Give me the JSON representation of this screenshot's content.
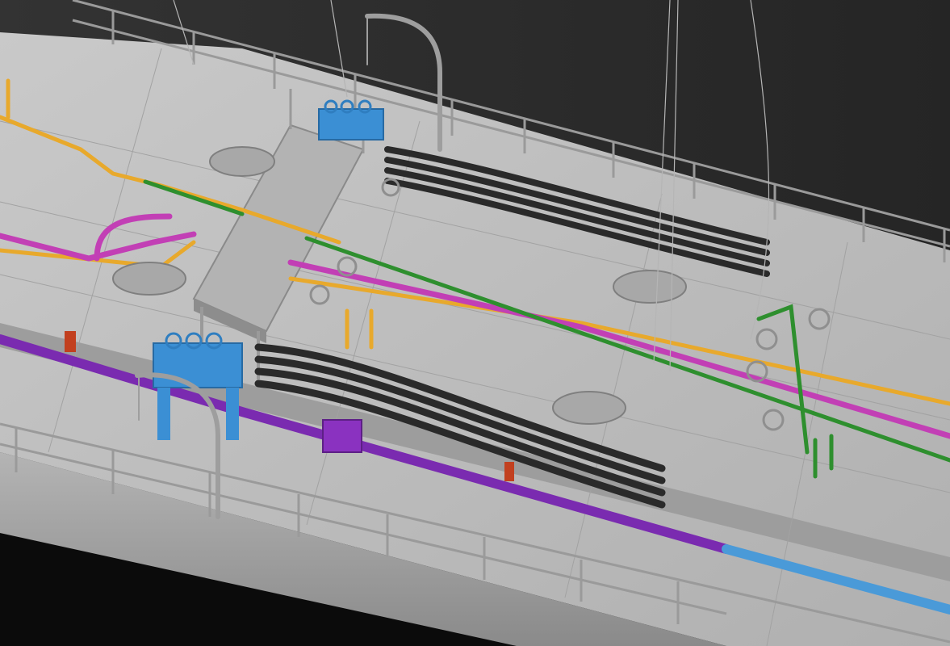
{
  "scene": {
    "subject": "tanker-deck-render",
    "colors": {
      "background": "#2a2a2a",
      "deck": "#bdbdbd",
      "deck_shadow": "#8f8f8f",
      "hull_side": "#a6a6a6",
      "water": "#0b0b0b",
      "railing": "#9a9a9a",
      "catwalk": "#b3b3b3",
      "pipe_yellow": "#e8a92c",
      "pipe_magenta": "#c23fb5",
      "pipe_green": "#2e8f2e",
      "pipe_purple": "#7a2bb0",
      "pipe_blue": "#4a9ad8",
      "valve_blue": "#3b8fd4",
      "hose_black": "#2a2a2a",
      "fitting_red": "#c2401f",
      "hatch": "#a8a8a8"
    },
    "objects": [
      {
        "name": "deck",
        "kind": "surface"
      },
      {
        "name": "hull-side",
        "kind": "surface"
      },
      {
        "name": "water",
        "kind": "surface"
      },
      {
        "name": "far-railing",
        "kind": "railing"
      },
      {
        "name": "near-railing",
        "kind": "railing"
      },
      {
        "name": "catwalk",
        "kind": "walkway"
      },
      {
        "name": "yellow-pipeline",
        "kind": "pipe"
      },
      {
        "name": "magenta-pipeline",
        "kind": "pipe"
      },
      {
        "name": "green-pipeline",
        "kind": "pipe"
      },
      {
        "name": "purple-pipeline",
        "kind": "pipe"
      },
      {
        "name": "blue-pipeline",
        "kind": "pipe"
      },
      {
        "name": "cargo-hoses-near",
        "kind": "hose-bundle"
      },
      {
        "name": "cargo-hoses-far",
        "kind": "hose-bundle"
      },
      {
        "name": "blue-manifold-near",
        "kind": "valve-manifold"
      },
      {
        "name": "blue-manifold-far",
        "kind": "valve-manifold"
      },
      {
        "name": "davit-crane-near",
        "kind": "crane"
      },
      {
        "name": "davit-crane-far",
        "kind": "crane"
      },
      {
        "name": "tank-hatch",
        "kind": "hatch"
      },
      {
        "name": "valve-handwheel",
        "kind": "valve"
      }
    ]
  }
}
